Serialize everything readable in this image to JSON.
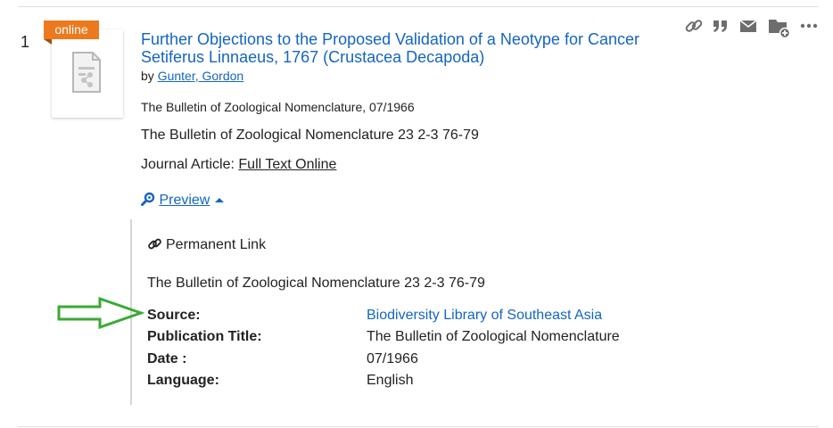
{
  "result": {
    "number": "1",
    "badge": "online",
    "title": "Further Objections to the Proposed Validation of a Neotype for Cancer Setiferus Linnaeus, 1767 (Crustacea Decapoda)",
    "by_prefix": "by",
    "author": "Gunter, Gordon",
    "journal_date": "The Bulletin of Zoological Nomenclature, 07/1966",
    "citation": "The Bulletin of Zoological Nomenclature 23 2-3 76-79",
    "type_label": "Journal Article:",
    "full_text_link": "Full Text Online",
    "preview_label": "Preview"
  },
  "toolbar": {
    "icons": [
      "link-icon",
      "quote-icon",
      "email-icon",
      "add-to-folder-icon",
      "more-icon"
    ]
  },
  "details": {
    "permanent_link": "Permanent Link",
    "citation": "The Bulletin of Zoological Nomenclature 23 2-3 76-79",
    "source_label": "Source:",
    "source_value": "Biodiversity Library of Southeast Asia",
    "pubtitle_label": "Publication Title:",
    "pubtitle_value": "The Bulletin of Zoological Nomenclature",
    "date_label": "Date :",
    "date_value": "07/1966",
    "language_label": "Language:",
    "language_value": "English"
  },
  "colors": {
    "link": "#1565c0",
    "badge": "#ec7a1d",
    "annotation_arrow": "#3aaa35"
  }
}
